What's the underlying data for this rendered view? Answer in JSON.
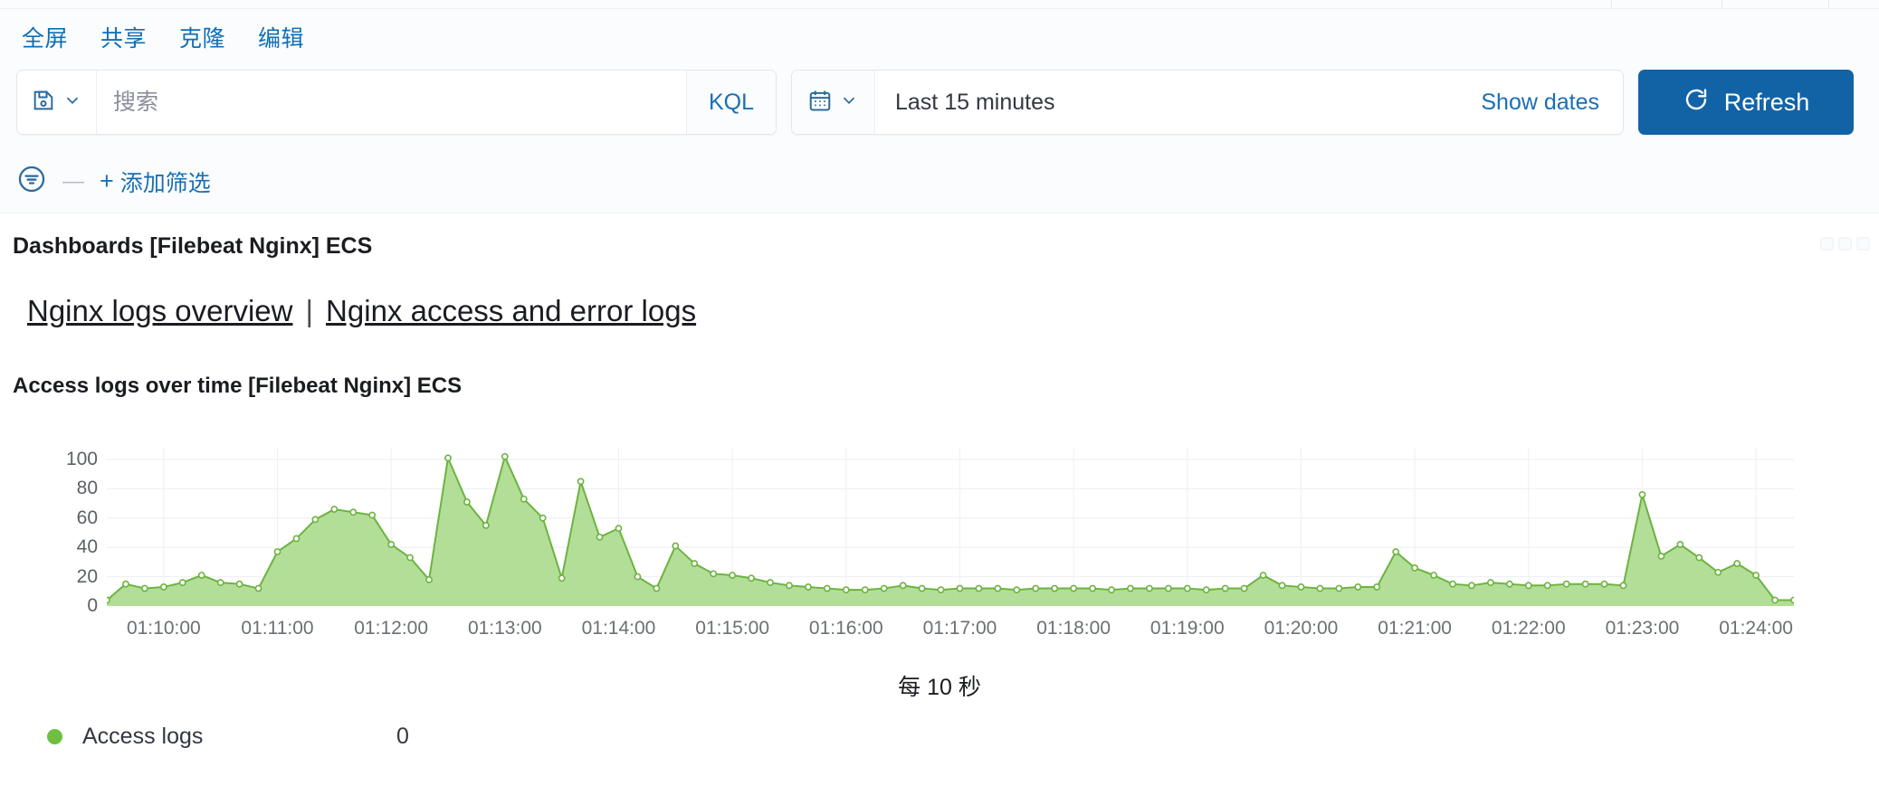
{
  "menubar": {
    "items": [
      {
        "label": "全屏",
        "name": "menu-fullscreen"
      },
      {
        "label": "共享",
        "name": "menu-share"
      },
      {
        "label": "克隆",
        "name": "menu-clone"
      },
      {
        "label": "编辑",
        "name": "menu-edit"
      }
    ]
  },
  "query": {
    "saved_query_icon": "save-icon",
    "dropdown_icon": "chevron-down-icon",
    "search_placeholder": "搜索",
    "search_value": "",
    "language_label": "KQL",
    "calendar_icon": "calendar-icon",
    "date_range": "Last 15 minutes",
    "show_dates_label": "Show dates",
    "refresh_label": "Refresh",
    "refresh_icon": "refresh-icon",
    "refresh_color": "#1263a6"
  },
  "filters": {
    "filter_icon": "filter-icon",
    "dash": "—",
    "add_filter_label": "添加筛选",
    "plus": "+"
  },
  "dashboard": {
    "title": "Dashboards [Filebeat Nginx] ECS",
    "links": [
      {
        "label": "Nginx logs overview",
        "name": "link-nginx-logs-overview"
      },
      {
        "label": "Nginx access and error logs",
        "name": "link-nginx-access-error-logs"
      }
    ],
    "link_separator": "|",
    "panel_title": "Access logs over time [Filebeat Nginx] ECS"
  },
  "chart_data": {
    "type": "area",
    "title": "Access logs over time [Filebeat Nginx] ECS",
    "xlabel": "每 10 秒",
    "ylabel": "",
    "ylim": [
      0,
      108
    ],
    "yticks": [
      0,
      20,
      40,
      60,
      80,
      100
    ],
    "grid": true,
    "legend_position": "bottom-left",
    "line_color": "#6cb33f",
    "fill_color": "#a9d98a",
    "marker_color": "#ffffff",
    "xtick_labels": [
      "01:10:00",
      "01:11:00",
      "01:12:00",
      "01:13:00",
      "01:14:00",
      "01:15:00",
      "01:16:00",
      "01:17:00",
      "01:18:00",
      "01:19:00",
      "01:20:00",
      "01:21:00",
      "01:22:00",
      "01:23:00",
      "01:24:00"
    ],
    "xtick_index": [
      3,
      9,
      15,
      21,
      27,
      33,
      39,
      45,
      51,
      57,
      63,
      69,
      75,
      81,
      87
    ],
    "series": [
      {
        "name": "Access logs",
        "legend_value": "0",
        "values": [
          4,
          15,
          12,
          13,
          16,
          21,
          16,
          15,
          12,
          37,
          46,
          59,
          66,
          64,
          62,
          42,
          33,
          18,
          101,
          71,
          55,
          102,
          73,
          60,
          19,
          85,
          47,
          53,
          20,
          12,
          41,
          29,
          22,
          21,
          19,
          16,
          14,
          13,
          12,
          11,
          11,
          12,
          14,
          12,
          11,
          12,
          12,
          12,
          11,
          12,
          12,
          12,
          12,
          11,
          12,
          12,
          12,
          12,
          11,
          12,
          12,
          21,
          14,
          13,
          12,
          12,
          13,
          13,
          37,
          26,
          21,
          15,
          14,
          16,
          15,
          14,
          14,
          15,
          15,
          15,
          14,
          76,
          34,
          42,
          33,
          23,
          29,
          21,
          4,
          4
        ]
      }
    ]
  }
}
